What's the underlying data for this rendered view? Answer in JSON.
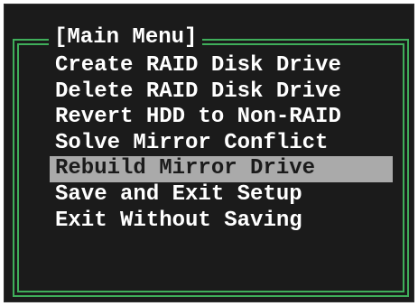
{
  "menu": {
    "title": "[Main Menu]",
    "items": [
      {
        "label": "Create RAID Disk Drive",
        "selected": false
      },
      {
        "label": "Delete RAID Disk Drive",
        "selected": false
      },
      {
        "label": "Revert HDD to Non-RAID",
        "selected": false
      },
      {
        "label": "Solve Mirror Conflict",
        "selected": false
      },
      {
        "label": "Rebuild Mirror Drive",
        "selected": true
      },
      {
        "label": "Save and Exit Setup",
        "selected": false
      },
      {
        "label": "Exit Without Saving",
        "selected": false
      }
    ]
  },
  "colors": {
    "background": "#1b1b1b",
    "frame": "#3fae5a",
    "text": "#ffffff",
    "highlight_bg": "#aaaaaa",
    "highlight_text": "#1b1b1b"
  }
}
